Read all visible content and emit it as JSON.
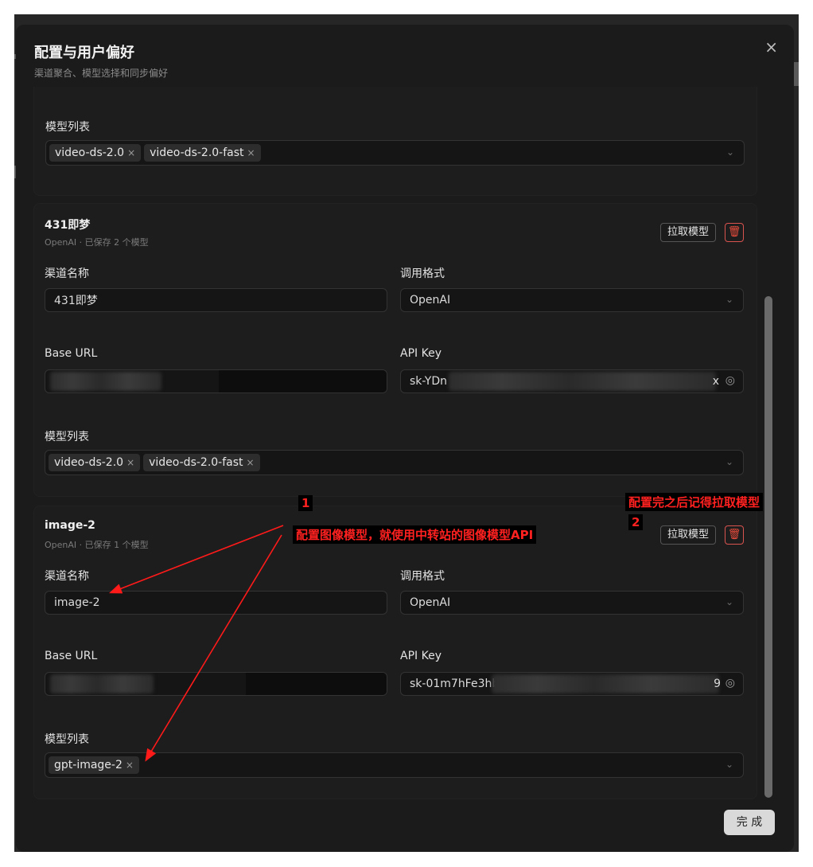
{
  "dialog": {
    "title": "配置与用户偏好",
    "subtitle": "渠道聚合、模型选择和同步偏好",
    "close_icon": "×",
    "done_label": "完 成"
  },
  "labels": {
    "model_list": "模型列表",
    "channel_name": "渠道名称",
    "call_format": "调用格式",
    "base_url": "Base URL",
    "api_key": "API Key",
    "pull_models": "拉取模型"
  },
  "top_partial": {
    "tags": [
      "video-ds-2.0",
      "video-ds-2.0-fast"
    ]
  },
  "channel_431": {
    "name": "431即梦",
    "meta": "OpenAI · 已保存 2 个模型",
    "name_value": "431即梦",
    "format_value": "OpenAI",
    "api_key_start": "sk-YDn",
    "api_key_end": "x",
    "tags": [
      "video-ds-2.0",
      "video-ds-2.0-fast"
    ]
  },
  "channel_image": {
    "name": "image-2",
    "meta": "OpenAI · 已保存 1 个模型",
    "name_value": "image-2",
    "format_value": "OpenAI",
    "api_key_start": "sk-01m7hFe3hb",
    "api_key_end": "9",
    "tags": [
      "gpt-image-2"
    ]
  },
  "annotations": {
    "n1": "1",
    "n2": "2",
    "text1": "配置图像模型，就使用中转站的图像模型API",
    "text2": "配置完之后记得拉取模型",
    "color": "#ff1a1a"
  },
  "icons": {
    "chevron": "chevron-down-icon",
    "eye": "eye-icon",
    "trash": "trash-icon",
    "tag_remove": "×"
  }
}
